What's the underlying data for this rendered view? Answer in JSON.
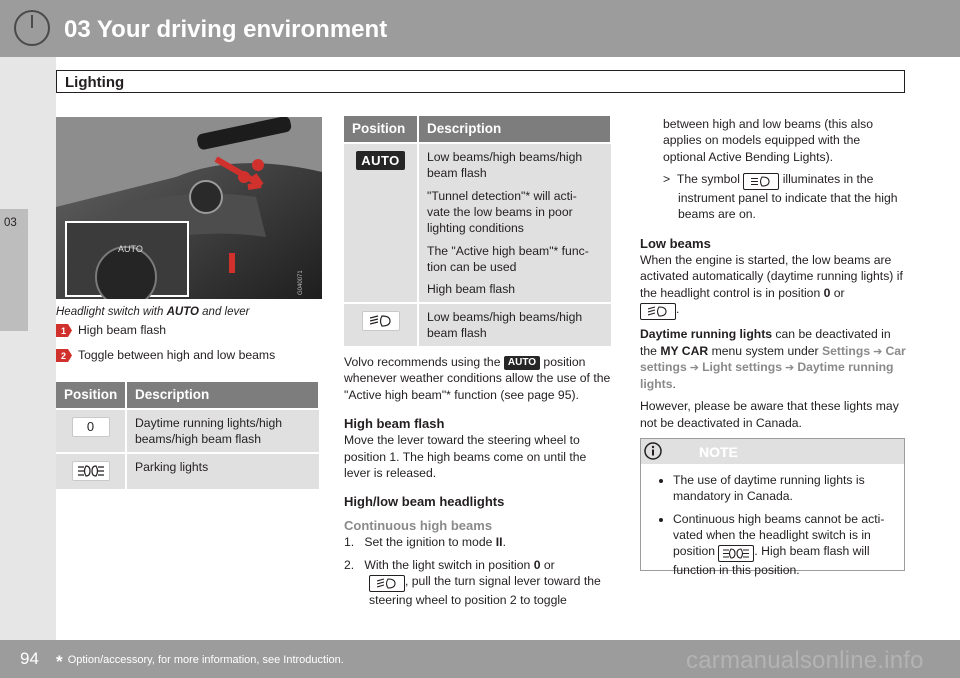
{
  "header": {
    "chapter_title": "03 Your driving environment",
    "section_title": "Lighting"
  },
  "sidebar": {
    "chapter_number": "03"
  },
  "figure": {
    "caption_prefix": "Headlight switch with ",
    "caption_bold": "AUTO",
    "caption_suffix": " and lever",
    "inset_label": "AUTO",
    "image_code": "G040071",
    "callouts": [
      {
        "number": "1",
        "text": "High beam flash"
      },
      {
        "number": "2",
        "text": "Toggle between high and low beams"
      }
    ]
  },
  "table_left": {
    "headers": [
      "Position",
      "Description"
    ],
    "rows": [
      {
        "symbol": "0",
        "description": "Daytime running lights/high beams/high beam flash"
      },
      {
        "symbol": "parking-lights-icon",
        "description": "Parking lights"
      }
    ]
  },
  "table_right": {
    "headers": [
      "Position",
      "Description"
    ],
    "rows": [
      {
        "symbol": "AUTO",
        "descriptions": [
          "Low beams/high beams/high beam flash",
          "\"Tunnel detection\"* will acti- vate the low beams in poor lighting conditions",
          "The \"Active high beam\"* func- tion can be used",
          "High beam flash"
        ]
      },
      {
        "symbol": "low-beam-icon",
        "descriptions": [
          "Low beams/high beams/high beam flash"
        ]
      }
    ]
  },
  "body_middle": {
    "recommend_prefix": "Volvo recommends using the ",
    "recommend_auto": "AUTO",
    "recommend_suffix": " position whenever weather conditions allow the use of the \"Active high beam\"* function (see page 95).",
    "high_beam_flash_heading": "High beam flash",
    "high_beam_flash_text": "Move the lever toward the steering wheel to position 1. The high beams come on until the lever is released.",
    "high_low_heading": "High/low beam headlights",
    "continuous_heading": "Continuous high beams",
    "step1_num": "1.",
    "step1_prefix": "Set the ignition to mode ",
    "step1_bold": "II",
    "step1_suffix": ".",
    "step2_num": "2.",
    "step2_prefix": "With the light switch in position ",
    "step2_bold": "0",
    "step2_mid": " or",
    "step2_suffix": ", pull the turn signal lever toward the steering wheel to position 2 to toggle"
  },
  "body_right": {
    "continuation": "between high and low beams (this also applies on models equipped with the optional Active Bending Lights).",
    "symbol_bullet_marker": ">",
    "symbol_bullet_prefix": "The symbol",
    "symbol_bullet_suffix": "illuminates in the instrument panel to indicate that the high beams are on.",
    "low_beams_heading": "Low beams",
    "low_beams_text_prefix": "When the engine is started, the low beams are activated automatically (daytime running lights) if the headlight control is in position ",
    "low_beams_bold": "0",
    "low_beams_text_mid": " or",
    "low_beams_text_end": ".",
    "drl_bold": "Daytime running lights",
    "drl_text": " can be deactivated in the ",
    "drl_menu": "MY CAR",
    "drl_text2": " menu system under ",
    "menu_path": [
      "Settings",
      "Car settings",
      "Light settings",
      "Daytime running lights"
    ],
    "drl_end": ".",
    "canada_text": "However, please be aware that these lights may not be deactivated in Canada."
  },
  "note": {
    "title": "NOTE",
    "item1": "The use of daytime running lights is mandatory in Canada.",
    "item2_prefix": "Continuous high beams cannot be acti- vated when the headlight switch is in position",
    "item2_suffix": ". High beam flash will function in this position."
  },
  "footer": {
    "page_number": "94",
    "footnote_star": "*",
    "footnote": "Option/accessory, for more information, see Introduction.",
    "watermark": "carmanualsonline.info"
  },
  "colors": {
    "header_gray": "#9c9c9c",
    "table_header": "#7d7d7d",
    "table_cell": "#e0e0e0",
    "callout_red": "#d0312d",
    "menu_gray": "#8a8a8a"
  }
}
